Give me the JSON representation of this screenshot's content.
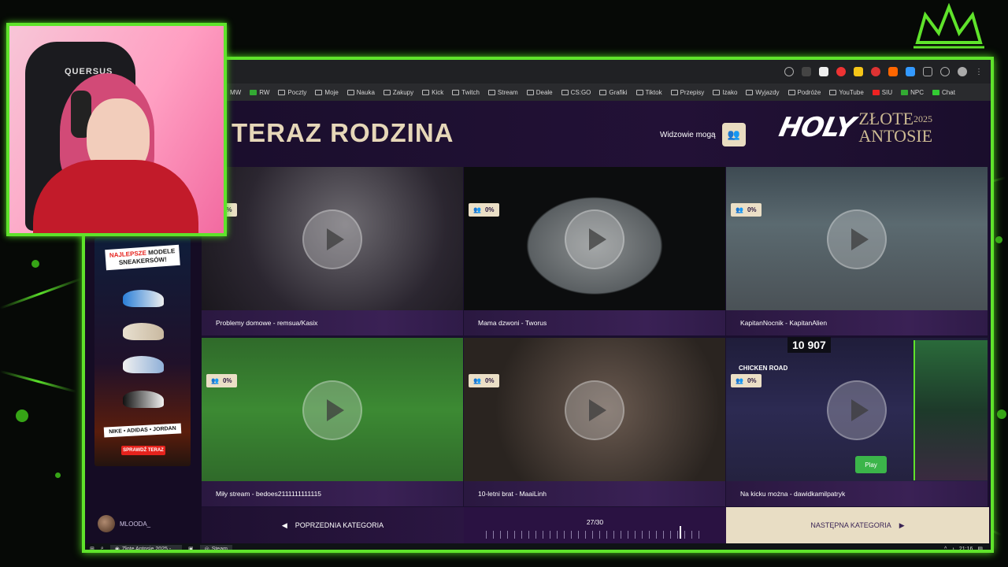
{
  "browser": {
    "bookmarks": [
      "MW",
      "RW",
      "Poczty",
      "Moje",
      "Nauka",
      "Zakupy",
      "Kick",
      "Twitch",
      "Stream",
      "Deale",
      "CS:GO",
      "Grafiki",
      "Tiktok",
      "Przepisy",
      "Izako",
      "Wyjazdy",
      "Podróże",
      "YouTube",
      "SIU",
      "NPC",
      "Chat"
    ]
  },
  "header": {
    "title": "TERAZ RODZINA",
    "viewers_label": "Widzowie mogą",
    "logo_brand": "HOLY",
    "logo_line1": "ZŁOTE",
    "logo_year": "2025",
    "logo_line2": "ANTOSIE"
  },
  "tiles": [
    {
      "caption": "Problemy domowe - remsua/Kasix",
      "percent": "0%"
    },
    {
      "caption": "Mama dzwoni - Tworus",
      "percent": "0%"
    },
    {
      "caption": "KapitanNocnik - KapitanAlien",
      "percent": "0%"
    },
    {
      "caption": "Miły stream - bedoes2111111111115",
      "percent": "0%"
    },
    {
      "caption": "10-letni brat - MaaiLinh",
      "percent": "0%"
    },
    {
      "caption": "Na kicku można - dawidkamilpatryk",
      "percent": "0%"
    }
  ],
  "overlay": {
    "counter": "10 907",
    "chicken_road": "CHICKEN ROAD",
    "play": "Play"
  },
  "footer": {
    "prev_label": "POPRZEDNIA KATEGORIA",
    "pager": "27/30",
    "next_label": "NASTĘPNA KATEGORIA"
  },
  "sidebar": {
    "username": "MLOODA_"
  },
  "ad": {
    "line1_red": "NAJLEPSZE",
    "line1": "MODELE",
    "line2": "SNEAKERSÓW!",
    "brands": "NIKE • ADIDAS • JORDAN",
    "cta": "SPRAWDŹ TERAZ"
  },
  "webcam": {
    "chair_brand": "QUERSUS"
  },
  "taskbar": {
    "app1": "Złote Antosie 2025 - ...",
    "app2": "Steam",
    "time": "21:16"
  },
  "colors": {
    "accent_green": "#5fe32b",
    "header_bg": "#1a0e2c",
    "tile_caption": "#2a1840",
    "gold": "#e6d7b8"
  }
}
